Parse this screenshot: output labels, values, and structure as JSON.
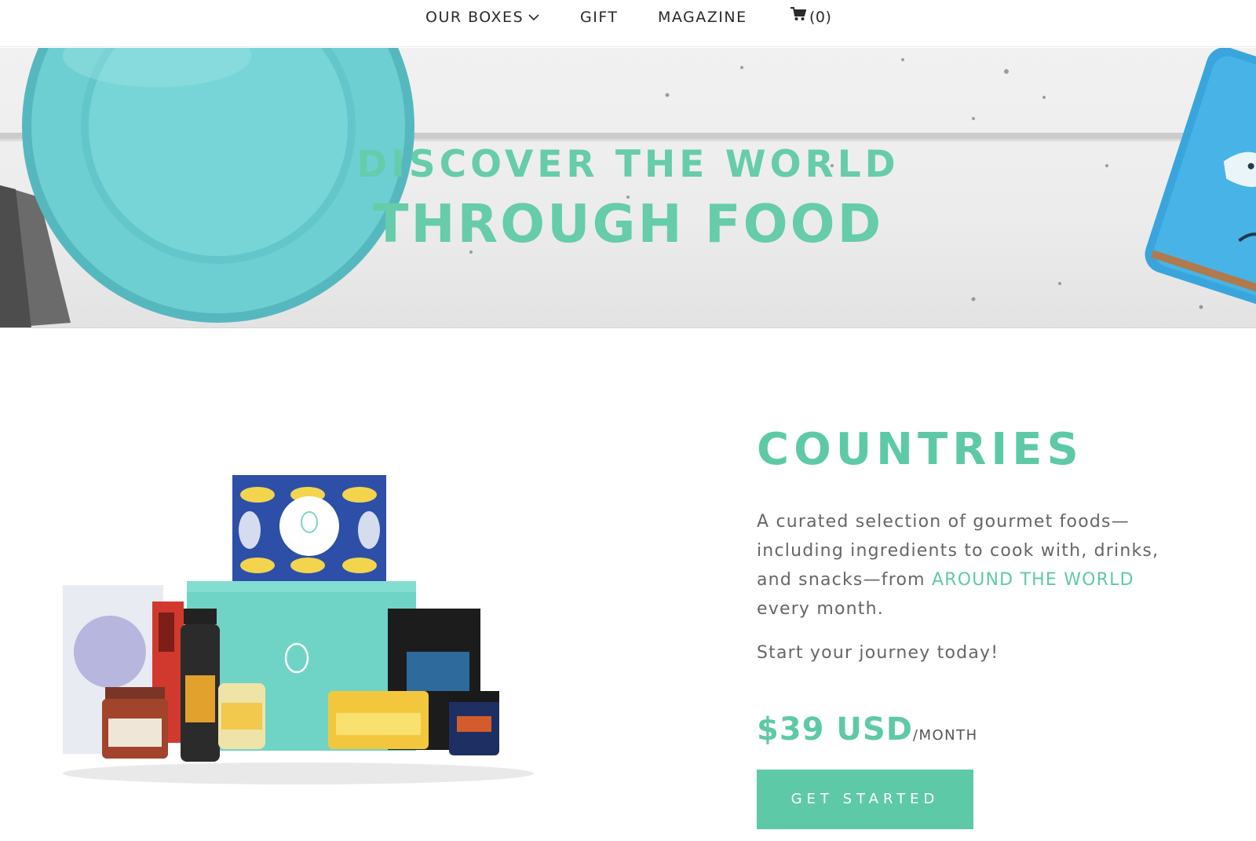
{
  "nav": {
    "items": [
      {
        "label": "OUR BOXES",
        "icon": "chevron-down-icon"
      },
      {
        "label": "GIFT"
      },
      {
        "label": "MAGAZINE"
      }
    ],
    "cart": {
      "icon": "cart-icon",
      "count_label": "(0)"
    }
  },
  "hero": {
    "line1": "DISCOVER THE WORLD",
    "line2": "THROUGH FOOD"
  },
  "product": {
    "title": "COUNTRIES",
    "description_before": "A curated selection of gourmet foods—including ingredients to cook with, drinks, and snacks—from ",
    "description_link": "AROUND THE WORLD",
    "description_after": " every month.",
    "journey": "Start your journey today!",
    "price": "$39 USD",
    "price_period": "/MONTH",
    "cta_label": "GET STARTED"
  },
  "colors": {
    "accent": "#5ec9a7",
    "text_muted": "#666666",
    "nav_text": "#2a2a2a"
  }
}
